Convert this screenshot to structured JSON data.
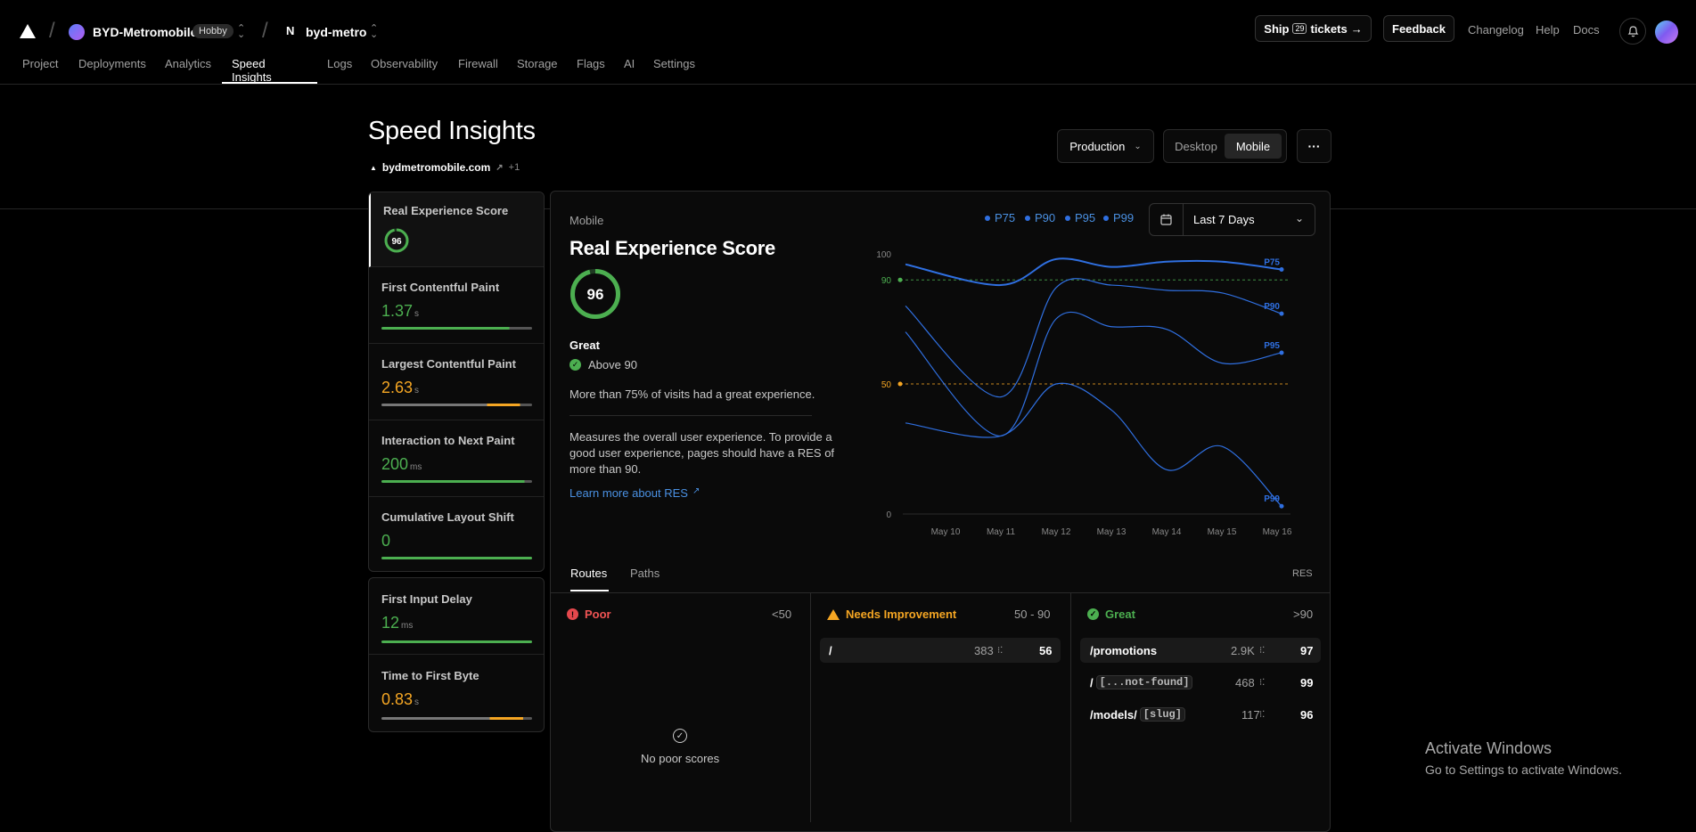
{
  "header": {
    "team_name": "BYD-Metromobile",
    "team_badge": "Hobby",
    "project_name": "byd-metro",
    "ship_label": "Ship",
    "ship_count": "29",
    "ship_suffix": "tickets",
    "feedback_label": "Feedback",
    "links": [
      "Changelog",
      "Help",
      "Docs"
    ]
  },
  "tabs": [
    "Project",
    "Deployments",
    "Analytics",
    "Speed Insights",
    "Logs",
    "Observability",
    "Firewall",
    "Storage",
    "Flags",
    "AI",
    "Settings"
  ],
  "active_tab": "Speed Insights",
  "page": {
    "title": "Speed Insights",
    "domain": "bydmetromobile.com",
    "domain_extra": "+1",
    "environment": "Production",
    "device_options": [
      "Desktop",
      "Mobile"
    ],
    "device_selected": "Mobile",
    "more_label": "···"
  },
  "sidebar": {
    "metrics": [
      {
        "title": "Real Experience Score",
        "value": "96",
        "unit": "",
        "color": "#4caf50"
      },
      {
        "title": "First Contentful Paint",
        "value": "1.37",
        "unit": "s",
        "color": "#4caf50"
      },
      {
        "title": "Largest Contentful Paint",
        "value": "2.63",
        "unit": "s",
        "color": "#f5a623"
      },
      {
        "title": "Interaction to Next Paint",
        "value": "200",
        "unit": "ms",
        "color": "#4caf50"
      },
      {
        "title": "Cumulative Layout Shift",
        "value": "0",
        "unit": "",
        "color": "#4caf50"
      }
    ],
    "extra_metrics": [
      {
        "title": "First Input Delay",
        "value": "12",
        "unit": "ms",
        "color": "#4caf50"
      },
      {
        "title": "Time to First Byte",
        "value": "0.83",
        "unit": "s",
        "color": "#f5a623"
      }
    ]
  },
  "panel": {
    "device": "Mobile",
    "title": "Real Experience Score",
    "score": "96",
    "rating": "Great",
    "rating_detail": "Above 90",
    "summary": "More than 75% of visits had a great experience.",
    "description": "Measures the overall user experience. To provide a good user experience, pages should have a RES of more than 90.",
    "learn_more": "Learn more about RES",
    "legend": [
      "P75",
      "P90",
      "P95",
      "P99"
    ],
    "date_range": "Last 7 Days"
  },
  "chart_data": {
    "type": "line",
    "x": [
      "May 10",
      "May 11",
      "May 12",
      "May 13",
      "May 14",
      "May 15",
      "May 16"
    ],
    "ylim": [
      0,
      100
    ],
    "yticks": [
      "100",
      "90",
      "50",
      "0"
    ],
    "thresholds": [
      {
        "value": 90,
        "color": "#4caf50"
      },
      {
        "value": 50,
        "color": "#f5a623"
      }
    ],
    "series": [
      {
        "name": "P75",
        "values": [
          96,
          88,
          98,
          95,
          97,
          97,
          94
        ]
      },
      {
        "name": "P90",
        "values": [
          80,
          45,
          87,
          88,
          86,
          85,
          77
        ]
      },
      {
        "name": "P95",
        "values": [
          70,
          30,
          75,
          72,
          71,
          58,
          62
        ]
      },
      {
        "name": "P99",
        "values": [
          35,
          30,
          50,
          40,
          17,
          26,
          3
        ]
      }
    ]
  },
  "routes": {
    "tabs": [
      "Routes",
      "Paths"
    ],
    "active_tab": "Routes",
    "right_label": "RES",
    "poor": {
      "label": "Poor",
      "range": "<50",
      "empty": "No poor scores"
    },
    "needs": {
      "label": "Needs Improvement",
      "range": "50 - 90",
      "rows": [
        {
          "route": "/",
          "visits": "383",
          "score": "56"
        }
      ]
    },
    "great": {
      "label": "Great",
      "range": ">90",
      "rows": [
        {
          "prefix": "/promotions",
          "code": "",
          "visits": "2.9K",
          "score": "97"
        },
        {
          "prefix": "/",
          "code": "[...not-found]",
          "visits": "468",
          "score": "99"
        },
        {
          "prefix": "/models/",
          "code": "[slug]",
          "visits": "117",
          "score": "96"
        }
      ]
    }
  },
  "watermark": {
    "title": "Activate Windows",
    "subtitle": "Go to Settings to activate Windows."
  }
}
